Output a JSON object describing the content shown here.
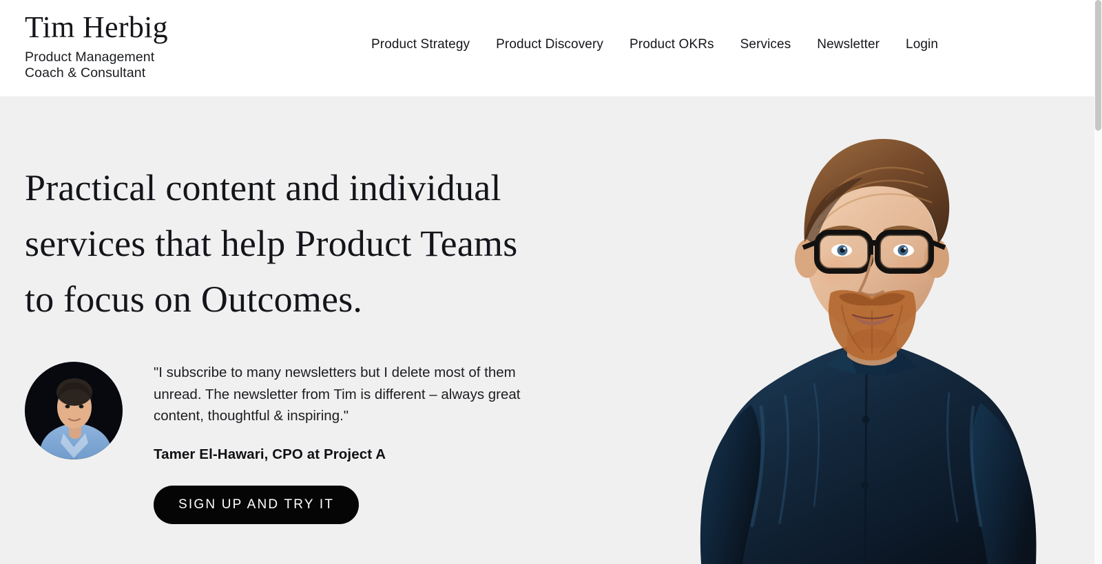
{
  "header": {
    "brand": {
      "name": "Tim Herbig",
      "tagline_line1": "Product Management",
      "tagline_line2": "Coach & Consultant"
    },
    "nav": [
      {
        "label": "Product Strategy",
        "name": "nav-link-product-strategy"
      },
      {
        "label": "Product Discovery",
        "name": "nav-link-product-discovery"
      },
      {
        "label": "Product OKRs",
        "name": "nav-link-product-okrs"
      },
      {
        "label": "Services",
        "name": "nav-link-services"
      },
      {
        "label": "Newsletter",
        "name": "nav-link-newsletter"
      },
      {
        "label": "Login",
        "name": "nav-link-login"
      }
    ]
  },
  "hero": {
    "headline_line1": "Practical content and individual",
    "headline_line2": "services that help Product Teams",
    "headline_line3": "to focus on Outcomes.",
    "testimonial": {
      "quote": "\"I subscribe to many newsletters but I delete most of them unread. The newsletter from Tim is different – always great content, thoughtful & inspiring.\"",
      "attribution": "Tamer El-Hawari, CPO at Project A",
      "avatar_alt": "portrait of Tamer El-Hawari"
    },
    "cta_label": "Sign up and try it",
    "portrait_alt": "portrait of Tim Herbig"
  },
  "colors": {
    "page_background": "#ffffff",
    "hero_background": "#f0f0f0",
    "text": "#14151a",
    "cta_background": "#050505",
    "cta_text": "#ffffff",
    "shirt_navy": "#13293f"
  }
}
